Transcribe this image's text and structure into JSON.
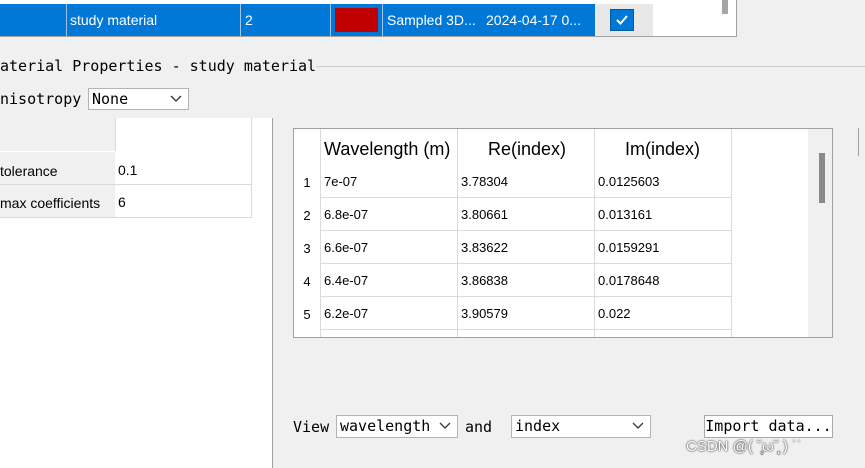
{
  "materials_row": {
    "name": "study material",
    "index": "2",
    "color": "#c00000",
    "type": "Sampled 3D...",
    "date": "2024-04-17 0...",
    "checked": true
  },
  "properties": {
    "title": "aterial Properties - study material",
    "anisotropy_label": "nisotropy",
    "anisotropy_value": "None"
  },
  "fit_params": [
    {
      "label": "tolerance",
      "value": "0.1"
    },
    {
      "label": "max coefficients",
      "value": "6"
    }
  ],
  "data_table": {
    "headers": [
      "Wavelength (m)",
      "Re(index)",
      "Im(index)"
    ],
    "rows": [
      {
        "num": "1",
        "wavelength": "7e-07",
        "re": "3.78304",
        "im": "0.0125603"
      },
      {
        "num": "2",
        "wavelength": "6.8e-07",
        "re": "3.80661",
        "im": "0.013161"
      },
      {
        "num": "3",
        "wavelength": "6.6e-07",
        "re": "3.83622",
        "im": "0.0159291"
      },
      {
        "num": "4",
        "wavelength": "6.4e-07",
        "re": "3.86838",
        "im": "0.0178648"
      },
      {
        "num": "5",
        "wavelength": "6.2e-07",
        "re": "3.90579",
        "im": "0.022"
      }
    ]
  },
  "view": {
    "label": "View",
    "x_value": "wavelength",
    "and_label": "and",
    "y_value": "index",
    "import_label": "Import data..."
  },
  "watermark": "CSDN @( ˘̩̩̩ω˘̩̩̩ ) ˙˙"
}
